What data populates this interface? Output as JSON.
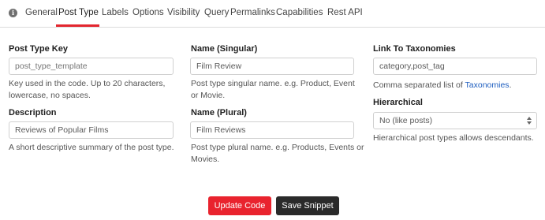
{
  "tabs": [
    {
      "label": "General"
    },
    {
      "label": "Post Type"
    },
    {
      "label": "Labels"
    },
    {
      "label": "Options"
    },
    {
      "label": "Visibility"
    },
    {
      "label": "Query"
    },
    {
      "label": "Permalinks"
    },
    {
      "label": "Capabilities"
    },
    {
      "label": "Rest API"
    }
  ],
  "info_icon": "info-icon",
  "fields": {
    "post_type_key": {
      "label": "Post Type Key",
      "placeholder": "post_type_template",
      "hint": "Key used in the code. Up to 20 characters, lowercase, no spaces."
    },
    "description": {
      "label": "Description",
      "value": "Reviews of Popular Films",
      "hint": "A short descriptive summary of the post type."
    },
    "name_singular": {
      "label": "Name (Singular)",
      "value": "Film Review",
      "hint": "Post type singular name. e.g. Product, Event or Movie."
    },
    "name_plural": {
      "label": "Name (Plural)",
      "value": "Film Reviews",
      "hint": "Post type plural name. e.g. Products, Events or Movies."
    },
    "link_taxonomies": {
      "label": "Link To Taxonomies",
      "value": "category,post_tag",
      "hint_prefix": "Comma separated list of ",
      "hint_link": "Taxonomies",
      "hint_suffix": "."
    },
    "hierarchical": {
      "label": "Hierarchical",
      "selected": "No (like posts)",
      "hint": "Hierarchical post types allows descendants."
    }
  },
  "buttons": {
    "update": "Update Code",
    "save": "Save Snippet"
  },
  "colors": {
    "accent_red": "#e9232e",
    "dark_button": "#2a2a2a",
    "link_blue": "#1e5ebf"
  }
}
